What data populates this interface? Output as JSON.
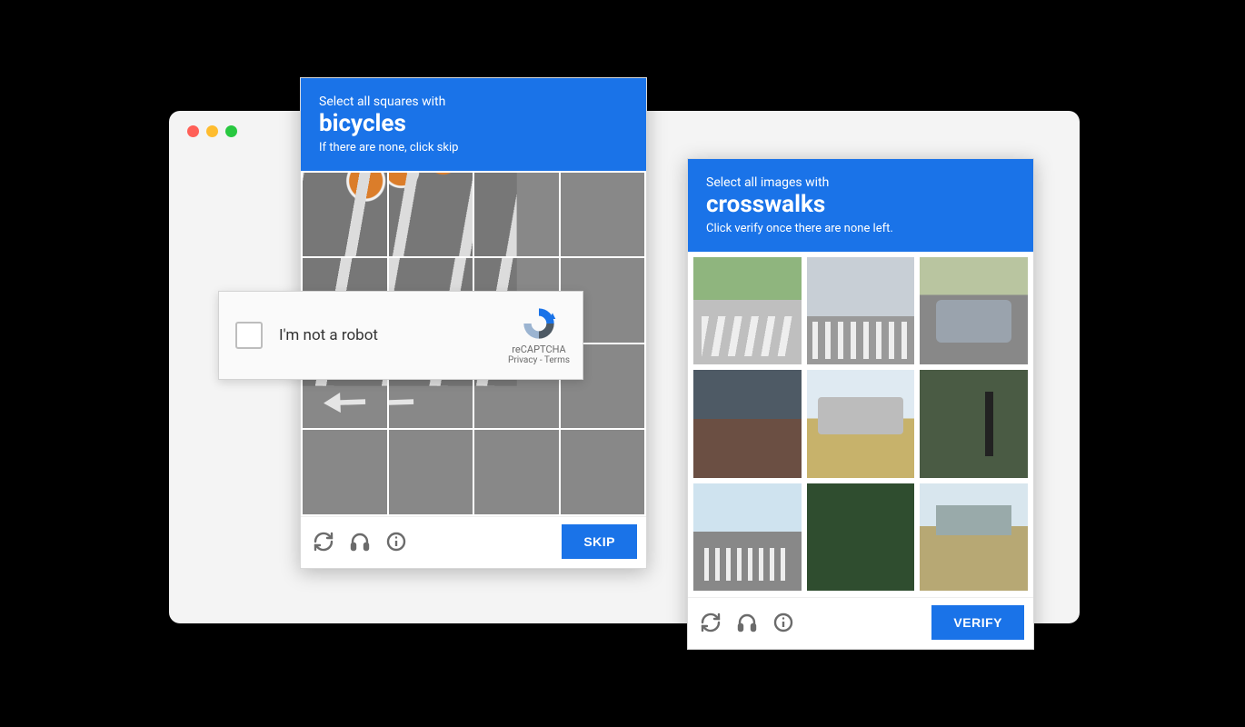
{
  "window": {
    "traffic": [
      "red",
      "yellow",
      "green"
    ]
  },
  "left_panel": {
    "header_small": "Select all squares with",
    "header_big": "bicycles",
    "header_sub": "If there are none, click skip",
    "action_label": "SKIP",
    "grid": {
      "rows": 4,
      "cols": 4
    }
  },
  "right_panel": {
    "header_small": "Select all images with",
    "header_big": "crosswalks",
    "header_sub": "Click verify once there are none left.",
    "action_label": "VERIFY",
    "grid": {
      "rows": 3,
      "cols": 3
    }
  },
  "footer_icons": {
    "refresh": "refresh-icon",
    "audio": "headphones-icon",
    "info": "info-icon"
  },
  "robot_widget": {
    "label": "I'm not a robot",
    "brand": "reCAPTCHA",
    "privacy": "Privacy",
    "terms": "Terms"
  },
  "colors": {
    "accent": "#1a73e8"
  }
}
